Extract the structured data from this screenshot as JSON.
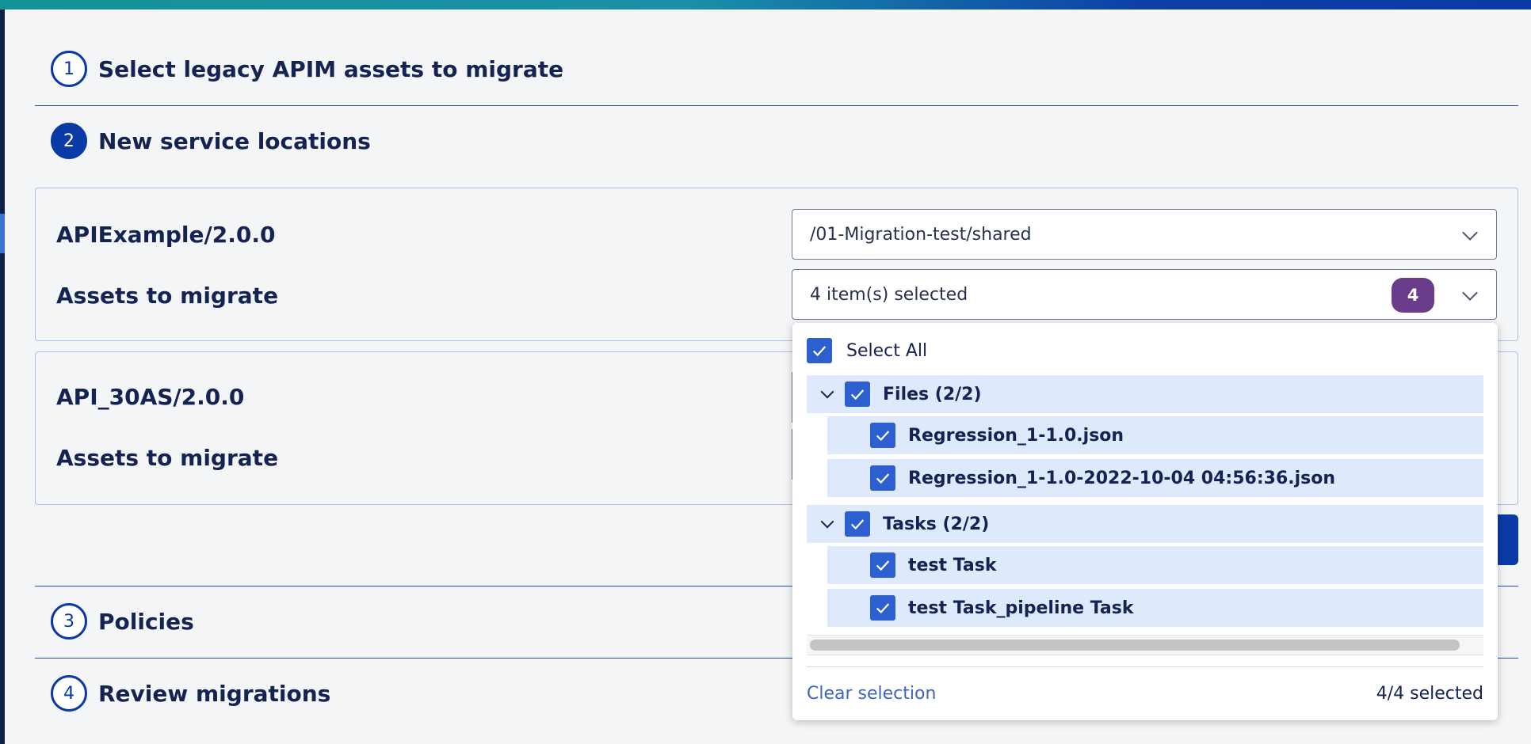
{
  "steps": [
    {
      "number": "1",
      "title": "Select legacy APIM assets to migrate"
    },
    {
      "number": "2",
      "title": "New service locations"
    },
    {
      "number": "3",
      "title": "Policies"
    },
    {
      "number": "4",
      "title": "Review migrations"
    }
  ],
  "services": [
    {
      "name": "APIExample/2.0.0",
      "location_value": "/01-Migration-test/shared",
      "assets_label": "Assets to migrate",
      "assets_value": "4 item(s) selected",
      "assets_badge": "4"
    },
    {
      "name": "API_30AS/2.0.0",
      "assets_label": "Assets to migrate"
    }
  ],
  "dropdown": {
    "select_all": "Select All",
    "groups": [
      {
        "label": "Files (2/2)",
        "items": [
          "Regression_1-1.0.json",
          "Regression_1-1.0-2022-10-04 04:56:36.json"
        ]
      },
      {
        "label": "Tasks (2/2)",
        "items": [
          "test Task",
          "test Task_pipeline Task"
        ]
      }
    ],
    "clear_selection": "Clear selection",
    "selected_count": "4/4 selected"
  },
  "colors": {
    "primary": "#0a3aa6",
    "checkbox": "#2e5fcf",
    "badge": "#6a3c8c",
    "row_highlight": "#dee9fb",
    "text": "#142352"
  }
}
